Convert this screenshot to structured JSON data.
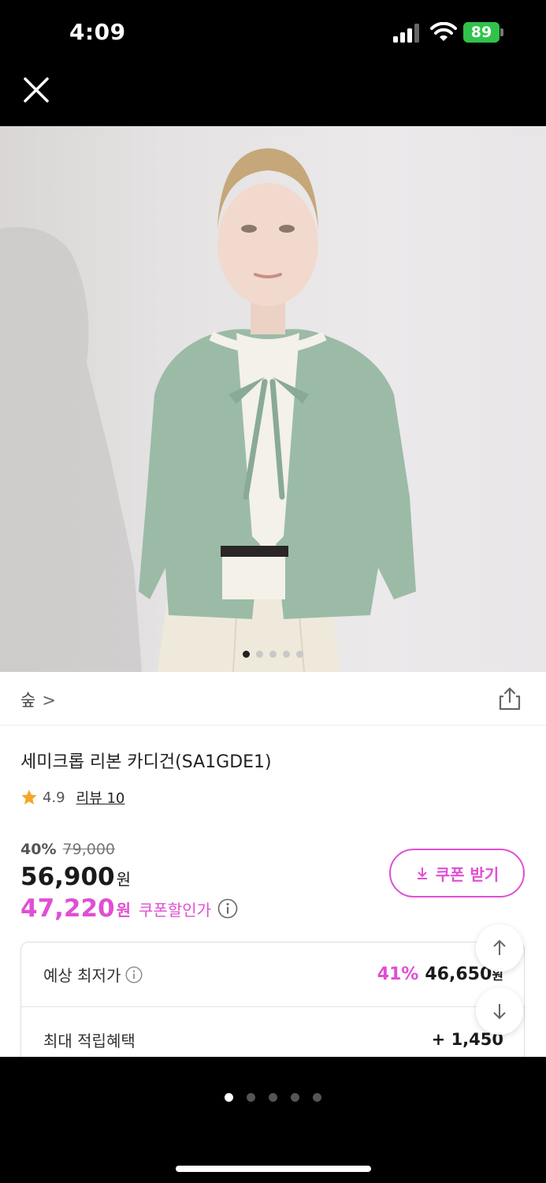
{
  "status_bar": {
    "time": "4:09",
    "battery": "89"
  },
  "header": {
    "close_icon": "close-icon"
  },
  "photo": {
    "description_icon": "product-photo",
    "dots_count": 5,
    "active_dot": 0
  },
  "brand": {
    "name": "숲",
    "chevron": ">"
  },
  "product": {
    "title": "세미크롭 리본 카디건(SA1GDE1)",
    "rating": "4.9",
    "review_label": "리뷰 10",
    "discount_rate": "40%",
    "original_price": "79,000",
    "price": "56,900",
    "price_unit": "원",
    "coupon_price": "47,220",
    "coupon_unit": "원",
    "coupon_label": "쿠폰할인가"
  },
  "coupon_button": {
    "label": "쿠폰 받기"
  },
  "benefits": {
    "lowest_label": "예상 최저가",
    "lowest_rate": "41%",
    "lowest_price": "46,650",
    "lowest_unit": "원",
    "points_label": "최대 적립혜택",
    "points_value": "+ 1,450"
  },
  "colors": {
    "accent": "#e04fd3",
    "battery": "#30c24a"
  },
  "page_indicator": {
    "count": 5,
    "active": 0
  }
}
